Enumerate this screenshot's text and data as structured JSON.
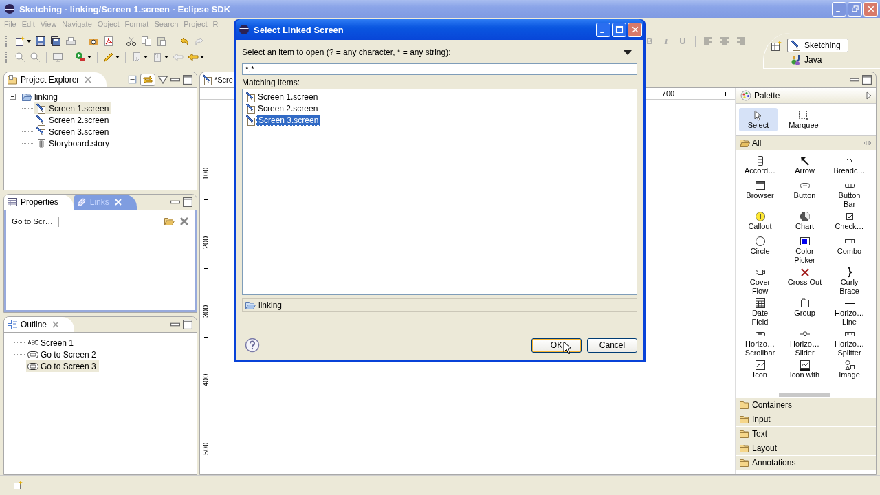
{
  "window": {
    "title": "Sketching - linking/Screen 1.screen - Eclipse SDK"
  },
  "menu": [
    "File",
    "Edit",
    "View",
    "Navigate",
    "Object",
    "Format",
    "Search",
    "Project",
    "R"
  ],
  "format_buttons": [
    {
      "label": "B",
      "disabled": true
    },
    {
      "label": "I",
      "disabled": true
    },
    {
      "label": "U",
      "disabled": true
    }
  ],
  "perspectives": [
    {
      "label": "Sketching",
      "selected": true
    },
    {
      "label": "Java",
      "selected": false
    }
  ],
  "project_explorer": {
    "title": "Project Explorer",
    "tree": [
      {
        "label": "linking",
        "expanded": true,
        "selected": false,
        "children": [
          {
            "label": "Screen 1.screen",
            "kind": "screen",
            "selected": true
          },
          {
            "label": "Screen 2.screen",
            "kind": "screen",
            "selected": false
          },
          {
            "label": "Screen 3.screen",
            "kind": "screen",
            "selected": false
          },
          {
            "label": "Storyboard.story",
            "kind": "story",
            "selected": false
          }
        ]
      }
    ]
  },
  "properties": {
    "tabs": [
      {
        "label": "Properties",
        "selected": false
      },
      {
        "label": "Links",
        "selected": true
      }
    ],
    "link_label": "Go to Scr…"
  },
  "outline": {
    "title": "Outline",
    "items": [
      {
        "label": "Screen 1",
        "kind": "label",
        "selected": false
      },
      {
        "label": "Go to Screen 2",
        "kind": "button",
        "selected": false
      },
      {
        "label": "Go to Screen 3",
        "kind": "button",
        "selected": true
      }
    ]
  },
  "editor": {
    "tab": "*Scre",
    "horizontal_ruler": [
      "700"
    ],
    "vertical_ruler": [
      "100",
      "200",
      "300",
      "400",
      "500"
    ]
  },
  "palette": {
    "title": "Palette",
    "tools": [
      {
        "label": "Select",
        "selected": true
      },
      {
        "label": "Marquee",
        "selected": false
      }
    ],
    "drawers": [
      {
        "label": "All",
        "expanded": true,
        "items": [
          "Accord…",
          "Arrow",
          "Breadc…",
          "Browser",
          "Button",
          "Button Bar",
          "Callout",
          "Chart",
          "Check…",
          "Circle",
          "Color Picker",
          "Combo",
          "Cover Flow",
          "Cross Out",
          "Curly Brace",
          "Date Field",
          "Group",
          "Horizo… Line",
          "Horizo… Scrollbar",
          "Horizo… Slider",
          "Horizo… Splitter",
          "Icon",
          "Icon with",
          "Image"
        ]
      },
      {
        "label": "Containers",
        "expanded": false
      },
      {
        "label": "Input",
        "expanded": false
      },
      {
        "label": "Text",
        "expanded": false
      },
      {
        "label": "Layout",
        "expanded": false
      },
      {
        "label": "Annotations",
        "expanded": false
      }
    ]
  },
  "dialog": {
    "title": "Select Linked Screen",
    "prompt": "Select an item to open (? = any character, * = any string):",
    "pattern": "*.*",
    "list_label": "Matching items:",
    "items": [
      {
        "label": "Screen 1.screen",
        "selected": false
      },
      {
        "label": "Screen 2.screen",
        "selected": false
      },
      {
        "label": "Screen 3.screen",
        "selected": true
      }
    ],
    "location": "linking",
    "buttons": [
      {
        "label": "OK",
        "focused": true
      },
      {
        "label": "Cancel",
        "focused": false
      }
    ]
  }
}
